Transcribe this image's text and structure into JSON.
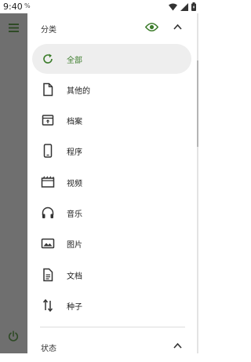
{
  "status_bar": {
    "time": "9:40",
    "indicator": "%"
  },
  "categories_section": {
    "title": "分类"
  },
  "categories": [
    {
      "label": "全部",
      "icon": "refresh-icon",
      "selected": true
    },
    {
      "label": "其他的",
      "icon": "file-icon",
      "selected": false
    },
    {
      "label": "档案",
      "icon": "archive-icon",
      "selected": false
    },
    {
      "label": "程序",
      "icon": "phone-app-icon",
      "selected": false
    },
    {
      "label": "视频",
      "icon": "video-icon",
      "selected": false
    },
    {
      "label": "音乐",
      "icon": "headphones-icon",
      "selected": false
    },
    {
      "label": "图片",
      "icon": "image-icon",
      "selected": false
    },
    {
      "label": "文档",
      "icon": "document-icon",
      "selected": false
    },
    {
      "label": "种子",
      "icon": "torrent-icon",
      "selected": false
    }
  ],
  "status_section": {
    "title": "状态"
  },
  "colors": {
    "accent": "#3d7d2c",
    "rail": "#6f6f6f",
    "selected_bg": "#eeeeee"
  }
}
